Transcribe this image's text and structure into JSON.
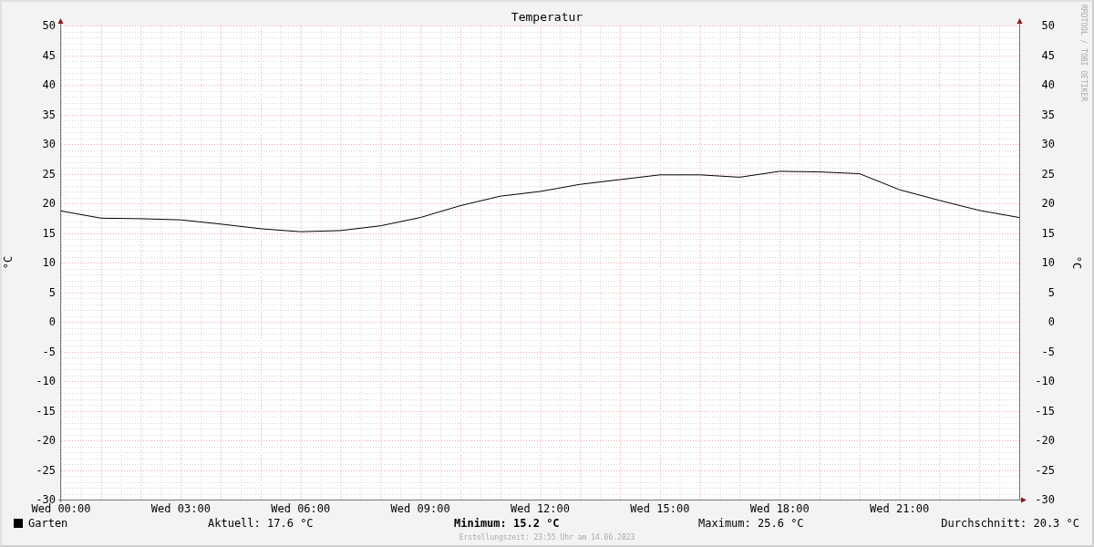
{
  "graph": {
    "chart_data": {
      "type": "line",
      "title": "Temperatur",
      "ylabel": "°C",
      "categories": [
        "Wed 00:00",
        null,
        null,
        "Wed 03:00",
        null,
        null,
        "Wed 06:00",
        null,
        null,
        "Wed 09:00",
        null,
        null,
        "Wed 12:00",
        null,
        null,
        "Wed 15:00",
        null,
        null,
        "Wed 18:00",
        null,
        null,
        "Wed 21:00",
        null,
        null,
        null
      ],
      "series": [
        {
          "name": "Garten",
          "color": "#000000",
          "values": [
            18.7,
            17.5,
            17.4,
            17.2,
            16.5,
            15.7,
            15.2,
            15.4,
            16.2,
            17.6,
            19.6,
            21.2,
            22.0,
            23.2,
            24.0,
            24.8,
            24.8,
            24.4,
            25.4,
            25.3,
            25.0,
            22.3,
            20.5,
            18.8,
            17.6
          ]
        }
      ],
      "ylim": [
        -30,
        50
      ],
      "grid": true,
      "yticks": [
        50,
        45,
        40,
        35,
        30,
        25,
        20,
        15,
        10,
        5,
        0,
        -5,
        -10,
        -15,
        -20,
        -25,
        -30
      ]
    },
    "right_axis": {
      "label": "°C",
      "ticks": [
        "50",
        "45",
        "40",
        "35",
        "30",
        "25",
        "20",
        "15",
        "10",
        "5",
        "0",
        "-5",
        "-10",
        "-15",
        "-20",
        "-25",
        "-30"
      ]
    },
    "credit": "RRDTOOL / TOBI OETIKER",
    "stats": [
      {
        "text": "Aktuell: 17.6 °C",
        "bold": false
      },
      {
        "text": "Minimum: 15.2 °C",
        "bold": true
      },
      {
        "text": "Maximum: 25.6 °C",
        "bold": false
      },
      {
        "text": "Durchschnitt: 20.3 °C",
        "bold": false
      }
    ],
    "footer": "Erstellungszeit: 23:55 Uhr am 14.06.2023"
  }
}
